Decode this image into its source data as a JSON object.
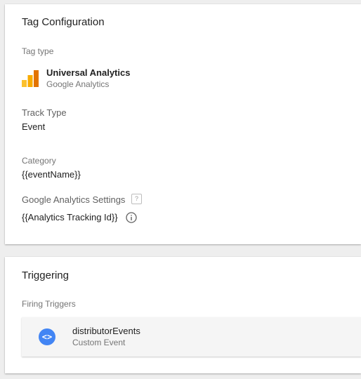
{
  "tag_config": {
    "title": "Tag Configuration",
    "tag_type_label": "Tag type",
    "tag_type_name": "Universal Analytics",
    "tag_type_vendor": "Google Analytics",
    "track_type_label": "Track Type",
    "track_type_value": "Event",
    "category_label": "Category",
    "category_value": "{{eventName}}",
    "ga_settings_label": "Google Analytics Settings",
    "ga_settings_help": "?",
    "ga_settings_value": "{{Analytics Tracking Id}}",
    "logo_icon": "google-analytics-logo",
    "info_icon": "info-icon"
  },
  "triggering": {
    "title": "Triggering",
    "firing_triggers_label": "Firing Triggers",
    "triggers": [
      {
        "name": "distributorEvents",
        "type": "Custom Event",
        "icon": "code-icon",
        "icon_glyph": "<>",
        "icon_color": "#4285f4"
      }
    ]
  },
  "colors": {
    "ga_orange_dark": "#e37400",
    "ga_orange": "#f9ab00",
    "ga_yellow": "#fbc02d",
    "trigger_blue": "#4285f4"
  }
}
